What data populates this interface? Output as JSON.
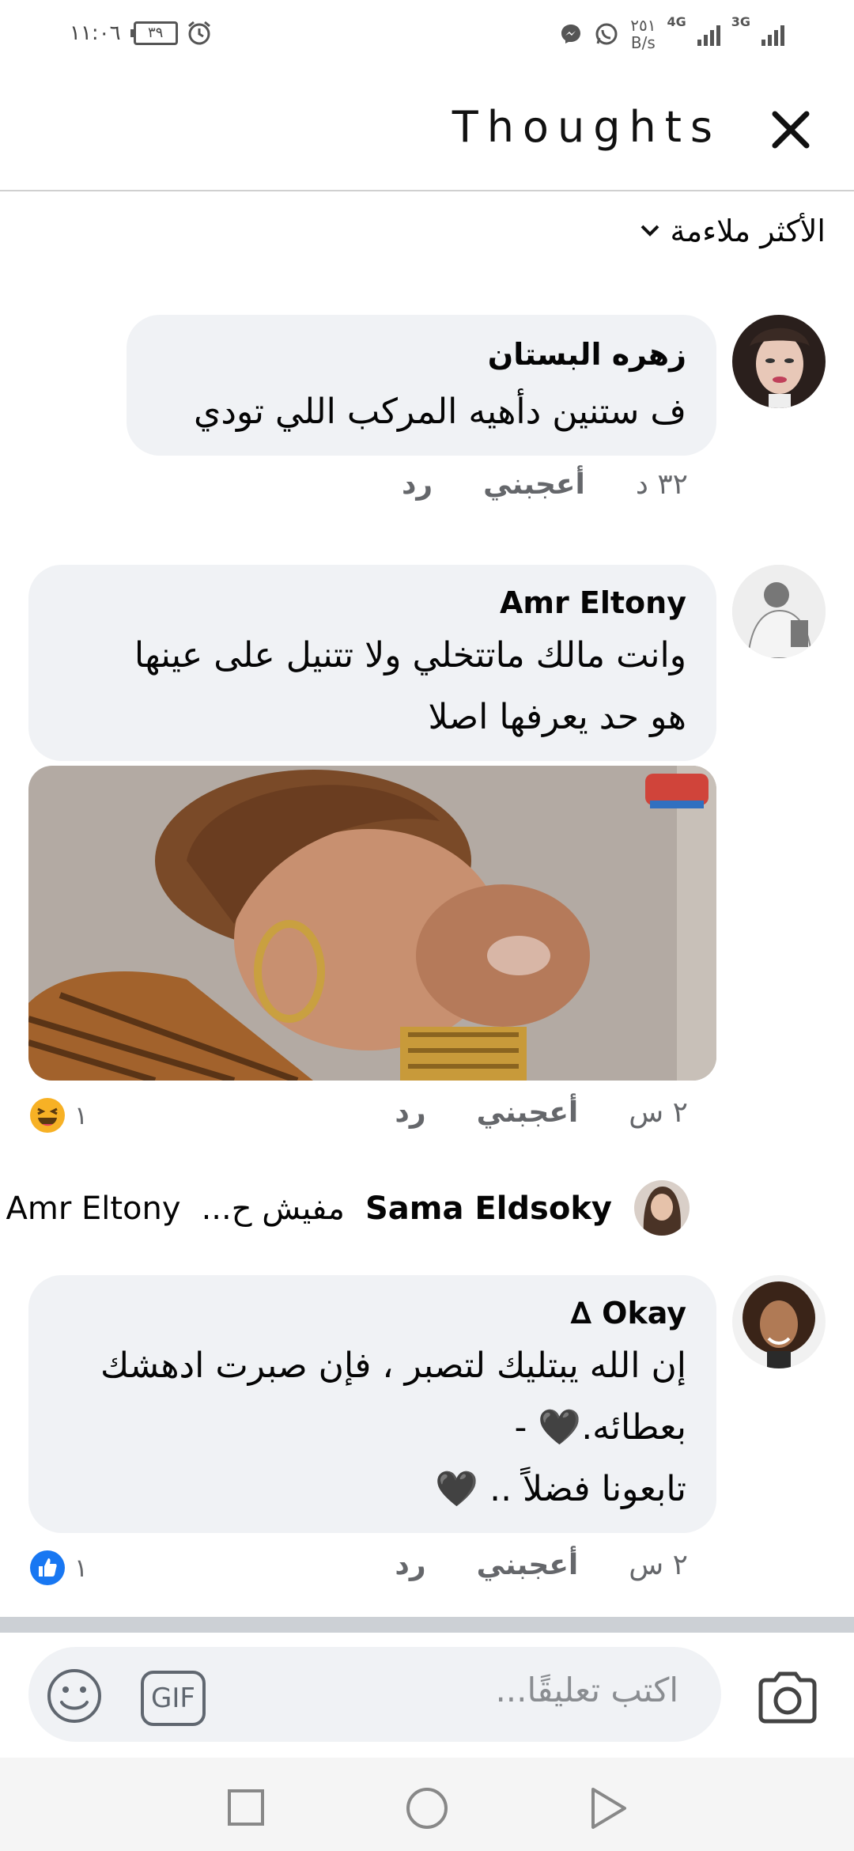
{
  "status_bar": {
    "time": "١١:٠٦",
    "battery": "٣٩",
    "net_speed_value": "٢٥١",
    "net_speed_unit": "B/s",
    "net1": "4G",
    "net2": "3G"
  },
  "header": {
    "title": "Thoughts"
  },
  "sort": {
    "label": "الأكثر ملاءمة"
  },
  "comments": [
    {
      "author": "زهره البستان",
      "lines": [
        "ف ستنين دأهيه المركب اللي تودي"
      ],
      "time": "٣٢ د",
      "like_label": "أعجبني",
      "reply_label": "رد"
    },
    {
      "author": "Amr Eltony",
      "lines": [
        "وانت مالك ماتتخلي ولا تتنيل على عينها",
        "هو حد يعرفها اصلا"
      ],
      "time": "٢ س",
      "like_label": "أعجبني",
      "reply_label": "رد",
      "reaction_count": "١"
    },
    {
      "author": "Okay ∆",
      "lines": [
        "إن الله يبتليك لتصبر ، فإن صبرت ادهشك",
        "بعطائه.🖤 -",
        "تابعونا فضلاً .. 🖤"
      ],
      "time": "٢ س",
      "like_label": "أعجبني",
      "reply_label": "رد",
      "reaction_count": "١"
    }
  ],
  "reply_preview": {
    "author": "Sama Eldsoky",
    "text": "مفيش ح...",
    "mention": "Amr Eltony"
  },
  "composer": {
    "placeholder": "اكتب تعليقًا...",
    "gif_label": "GIF"
  },
  "colors": {
    "bubble": "#f0f2f5",
    "meta_text": "#65676b",
    "like_blue": "#1877f2",
    "haha_yellow": "#f7b125"
  }
}
